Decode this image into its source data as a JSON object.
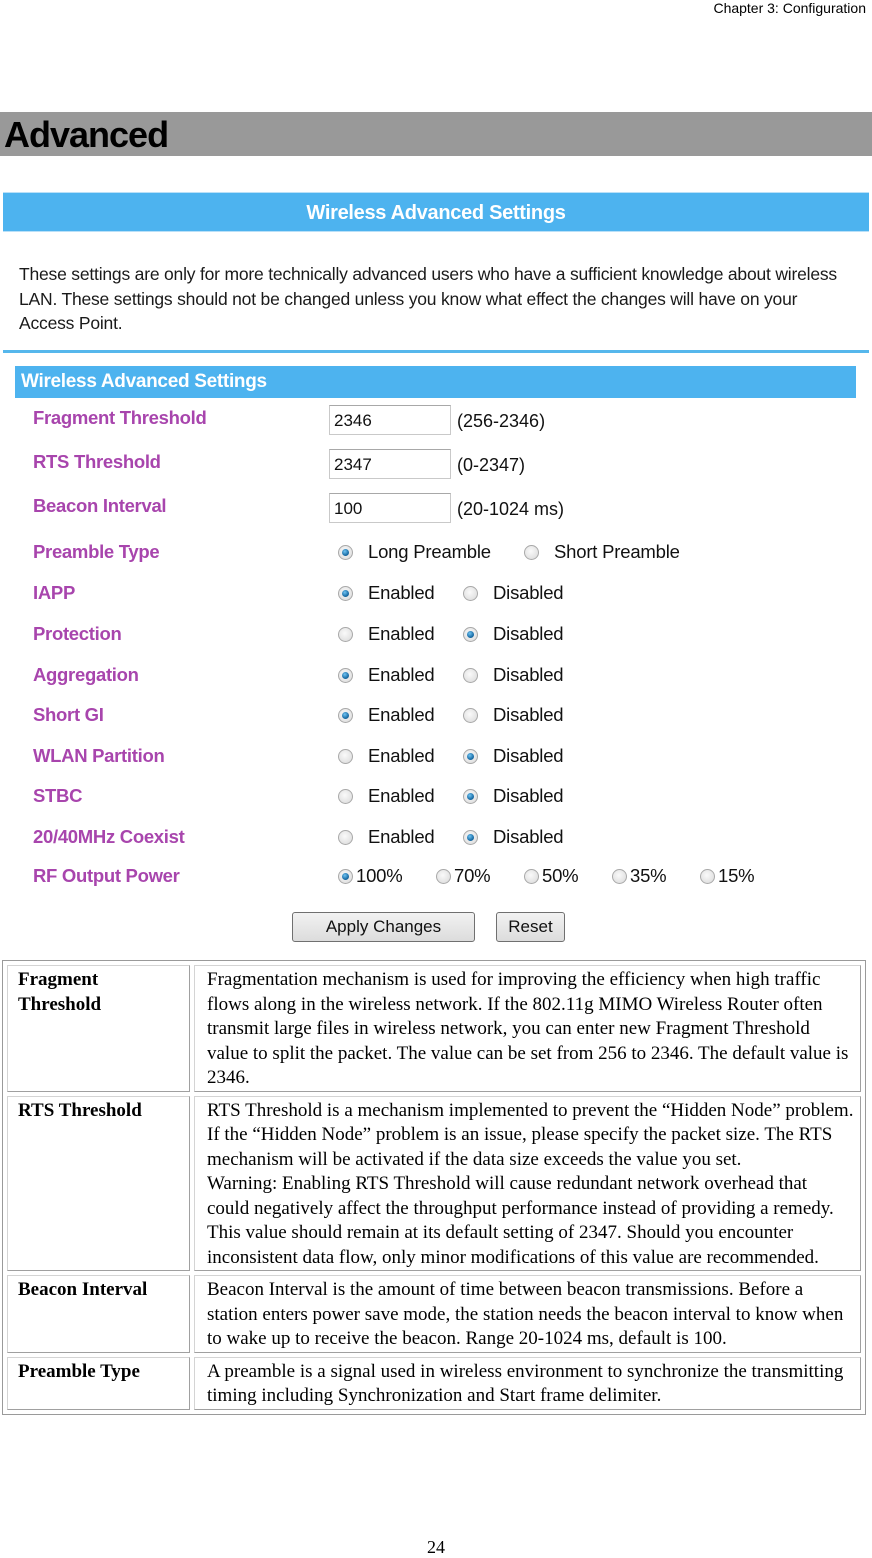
{
  "running_header": "Chapter 3: Configuration",
  "section_title": "Advanced",
  "screenshot": {
    "banner_title": "Wireless Advanced Settings",
    "intro_text": "These settings are only for more technically advanced users who have a sufficient knowledge about wireless LAN. These settings should not be changed unless you know what effect the changes will have on your Access Point.",
    "section_header": "Wireless Advanced Settings",
    "colors": {
      "banner": "#4db3ef",
      "label": "#a845ad",
      "radio_selected": "#1c6fa8"
    },
    "text_fields": [
      {
        "label": "Fragment Threshold",
        "value": "2346",
        "range": "(256-2346)"
      },
      {
        "label": "RTS Threshold",
        "value": "2347",
        "range": "(0-2347)"
      },
      {
        "label": "Beacon Interval",
        "value": "100",
        "range": "(20-1024 ms)"
      }
    ],
    "preamble": {
      "label": "Preamble Type",
      "options": [
        "Long Preamble",
        "Short Preamble"
      ],
      "selected": "Long Preamble"
    },
    "toggles": [
      {
        "label": "IAPP",
        "options": [
          "Enabled",
          "Disabled"
        ],
        "selected": "Enabled"
      },
      {
        "label": "Protection",
        "options": [
          "Enabled",
          "Disabled"
        ],
        "selected": "Disabled"
      },
      {
        "label": "Aggregation",
        "options": [
          "Enabled",
          "Disabled"
        ],
        "selected": "Enabled"
      },
      {
        "label": "Short GI",
        "options": [
          "Enabled",
          "Disabled"
        ],
        "selected": "Enabled"
      },
      {
        "label": "WLAN Partition",
        "options": [
          "Enabled",
          "Disabled"
        ],
        "selected": "Disabled"
      },
      {
        "label": "STBC",
        "options": [
          "Enabled",
          "Disabled"
        ],
        "selected": "Disabled"
      },
      {
        "label": "20/40MHz Coexist",
        "options": [
          "Enabled",
          "Disabled"
        ],
        "selected": "Disabled"
      }
    ],
    "rf_output_power": {
      "label": "RF Output Power",
      "options": [
        "100%",
        "70%",
        "50%",
        "35%",
        "15%"
      ],
      "selected": "100%"
    },
    "buttons": {
      "apply": "Apply Changes",
      "reset": "Reset"
    }
  },
  "descriptions": [
    {
      "term": "Fragment Threshold",
      "paragraphs": [
        "Fragmentation mechanism is used for improving the efficiency when high traffic flows along in the wireless network. If the 802.11g MIMO Wireless Router often transmit large files in wireless network, you can enter new Fragment Threshold value to split the packet.  The value can be set from 256 to 2346. The default value is 2346."
      ]
    },
    {
      "term": "RTS Threshold",
      "paragraphs": [
        "RTS Threshold is a mechanism implemented to prevent the “Hidden Node” problem. If the “Hidden Node” problem is an issue, please specify the packet size. The RTS mechanism will be activated if the data size exceeds the value you set.",
        "Warning: Enabling RTS Threshold will cause redundant network overhead that could negatively affect the throughput performance instead of providing a remedy.",
        "This value should remain at its default setting of 2347.  Should you encounter inconsistent data flow, only minor modifications of this value are recommended."
      ]
    },
    {
      "term": "Beacon Interval",
      "paragraphs": [
        "Beacon Interval is the amount of time between beacon transmissions. Before a station enters power save mode, the station needs the beacon interval to know when to wake up to receive the beacon. Range 20-1024 ms, default is 100."
      ]
    },
    {
      "term": "Preamble Type",
      "paragraphs": [
        "A preamble is a signal used in wireless environment to synchronize the transmitting timing including Synchronization and Start frame delimiter."
      ]
    }
  ],
  "page_number": "24"
}
